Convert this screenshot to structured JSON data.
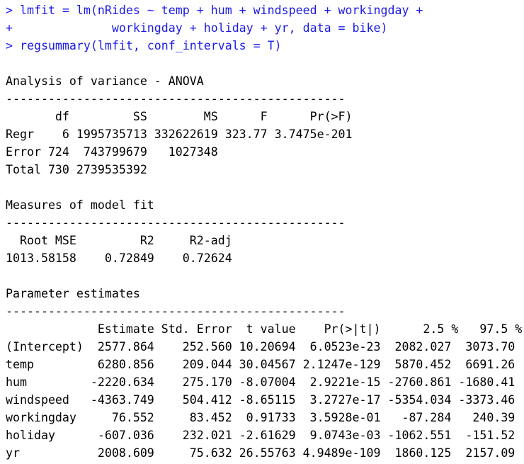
{
  "console": {
    "input_color": "#1a1ae6",
    "output_color": "#000000",
    "input": [
      "> lmfit = lm(nRides ~ temp + hum + windspeed + workingday +",
      "+              workingday + holiday + yr, data = bike)",
      "> regsummary(lmfit, conf_intervals = T)"
    ],
    "anova": {
      "blank": "",
      "title": "Analysis of variance - ANOVA",
      "rule": "------------------------------------------------",
      "header": "       df         SS        MS      F      Pr(>F)",
      "rows": [
        "Regr    6 1995735713 332622619 323.77 3.7475e-201",
        "Error 724  743799679   1027348",
        "Total 730 2739535392"
      ]
    },
    "fit": {
      "blank": "",
      "title": "Measures of model fit",
      "rule": "------------------------------------------------",
      "header": "  Root MSE         R2     R2-adj",
      "row": "1013.58158    0.72849    0.72624"
    },
    "params": {
      "blank": "",
      "title": "Parameter estimates",
      "rule": "------------------------------------------------",
      "header": "             Estimate Std. Error  t value    Pr(>|t|)      2.5 %   97.5 %",
      "rows": [
        "(Intercept)  2577.864    252.560 10.20694  6.0523e-23  2082.027  3073.70",
        "temp         6280.856    209.044 30.04567 2.1247e-129  5870.452  6691.26",
        "hum         -2220.634    275.170 -8.07004  2.9221e-15 -2760.861 -1680.41",
        "windspeed   -4363.749    504.412 -8.65115  3.2727e-17 -5354.034 -3373.46",
        "workingday     76.552     83.452  0.91733  3.5928e-01   -87.284   240.39",
        "holiday      -607.036    232.021 -2.61629  9.0743e-03 -1062.551  -151.52",
        "yr           2008.609     75.632 26.55763 4.9489e-109  1860.125  2157.09"
      ]
    }
  }
}
